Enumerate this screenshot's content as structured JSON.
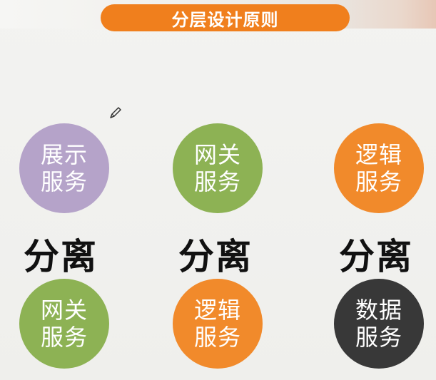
{
  "slide": {
    "title": "分层设计原则",
    "separator": "分离",
    "top_row": [
      {
        "line1": "展示",
        "line2": "服务",
        "color": "#b5a3c9"
      },
      {
        "line1": "网关",
        "line2": "服务",
        "color": "#8db254"
      },
      {
        "line1": "逻辑",
        "line2": "服务",
        "color": "#f18a2b"
      }
    ],
    "bottom_row": [
      {
        "line1": "网关",
        "line2": "服务",
        "color": "#8db254"
      },
      {
        "line1": "逻辑",
        "line2": "服务",
        "color": "#f18a2b"
      },
      {
        "line1": "数据",
        "line2": "服务",
        "color": "#383838"
      }
    ]
  }
}
